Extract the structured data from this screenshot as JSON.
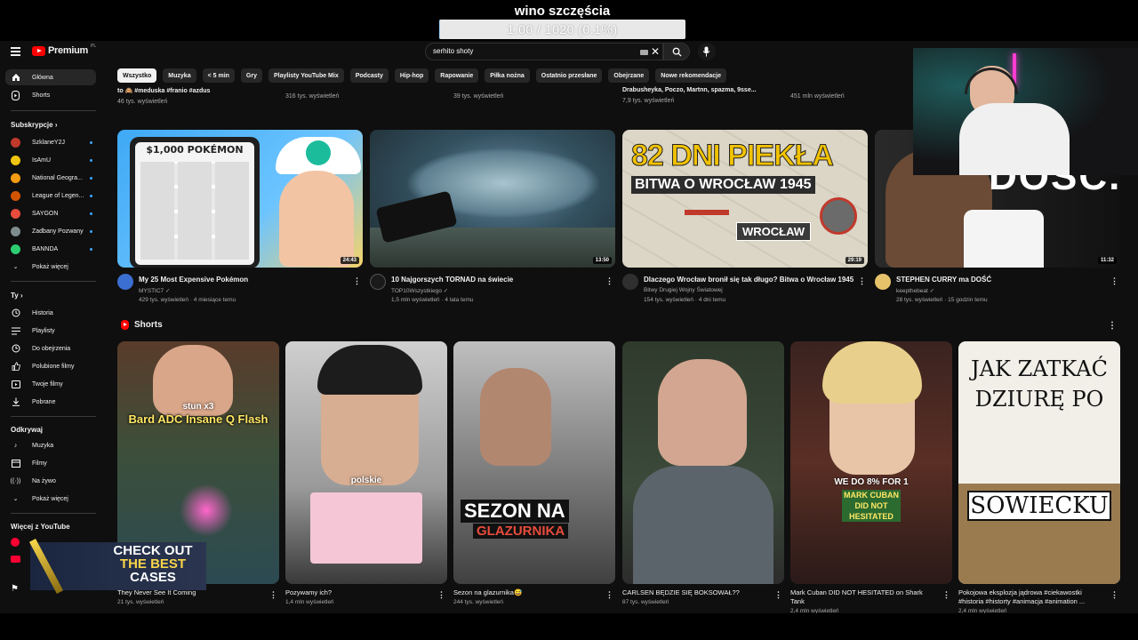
{
  "overlay": {
    "title": "wino szczęścia",
    "progress_text": "1.00 / 1020 (0.1%)",
    "progress_fraction": 0.001
  },
  "masthead": {
    "logo_text": "Premium",
    "logo_region": "PL",
    "search_value": "serhito shoty"
  },
  "sidebar": {
    "main": [
      {
        "label": "Główna",
        "icon": "home-icon"
      },
      {
        "label": "Shorts",
        "icon": "shorts-icon"
      }
    ],
    "subs_head": "Subskrypcje",
    "subs": [
      {
        "label": "SzklaneY2J",
        "color": "#c0392b"
      },
      {
        "label": "IsAmU",
        "color": "#f1c40f"
      },
      {
        "label": "National Geogra...",
        "color": "#f39c12"
      },
      {
        "label": "League of Legen...",
        "color": "#d35400"
      },
      {
        "label": "SAYGON",
        "color": "#e74c3c"
      },
      {
        "label": "Zadbany Pozwany",
        "color": "#7f8c8d"
      },
      {
        "label": "BANNDA",
        "color": "#2ecc71"
      }
    ],
    "subs_more": "Pokaż więcej",
    "you_head": "Ty",
    "you": [
      {
        "label": "Historia",
        "icon": "history-icon"
      },
      {
        "label": "Playlisty",
        "icon": "playlist-icon"
      },
      {
        "label": "Do obejrzenia",
        "icon": "watch-later-icon"
      },
      {
        "label": "Polubione filmy",
        "icon": "like-icon"
      },
      {
        "label": "Twoje filmy",
        "icon": "your-videos-icon"
      },
      {
        "label": "Pobrane",
        "icon": "download-icon"
      }
    ],
    "explore_head": "Odkrywaj",
    "explore": [
      {
        "label": "Muzyka",
        "icon": "music-icon"
      },
      {
        "label": "Filmy",
        "icon": "movies-icon"
      },
      {
        "label": "Na żywo",
        "icon": "live-icon"
      },
      {
        "label": "Pokaż więcej",
        "icon": "chevron-down-icon"
      }
    ],
    "more_head": "Więcej z YouTube"
  },
  "chips": [
    "Wszystko",
    "Muzyka",
    "< 5 min",
    "Gry",
    "Playlisty YouTube Mix",
    "Podcasty",
    "Hip-hop",
    "Rapowanie",
    "Piłka nożna",
    "Ostatnio przesłane",
    "Obejrzane",
    "Nowe rekomendacje"
  ],
  "partial_row": [
    {
      "title": "to 🙈 #meduska #franio #azdus",
      "stats": "46 tys. wyświetleń"
    },
    {
      "title": "",
      "stats": "316 tys. wyświetleń"
    },
    {
      "title": "",
      "stats": "39 tys. wyświetleń"
    },
    {
      "title": "Drabusheyka, Poczo, Martnn, spazma, 9sse...",
      "stats": "7,9 tys. wyświetleń"
    },
    {
      "title": "",
      "stats": "451 mln wyświetleń"
    }
  ],
  "videos": [
    {
      "title": "My 25 Most Expensive Pokémon",
      "channel": "MYSTIC7",
      "stats": "429 tys. wyświetleń · 4 miesiące temu",
      "duration": "24:43",
      "thumb_text": "$1,000 POKÉMON"
    },
    {
      "title": "10 Najgorszych TORNAD na świecie",
      "channel": "TOP10Wszystkiego",
      "stats": "1,5 mln wyświetleń · 4 lata temu",
      "duration": "13:50",
      "thumb_text": ""
    },
    {
      "title": "Dlaczego Wrocław bronił się tak długo? Bitwa o Wrocław 1945",
      "channel": "Bitwy Drugiej Wojny Światowej",
      "stats": "154 tys. wyświetleń · 4 dni temu",
      "duration": "29:19",
      "thumb_text": "82 DNI PIEKŁA",
      "thumb_sub": "BITWA O WROCŁAW 1945",
      "thumb_tag": "WROCŁAW"
    },
    {
      "title": "STEPHEN CURRY ma DOŚĆ",
      "channel": "keepthebeat",
      "stats": "28 tys. wyświetleń · 15 godzin temu",
      "duration": "11:32",
      "thumb_text": "DOŚĆ."
    }
  ],
  "shorts_head": "Shorts",
  "shorts": [
    {
      "title": "They Never See It Coming",
      "stats": "21 tys. wyświetleń",
      "thumb_text": "Bard ADC Insane Q Flash",
      "thumb_sub": "stun x3"
    },
    {
      "title": "Pozywamy ich?",
      "stats": "1,4 mln wyświetleń",
      "thumb_text": "polskie"
    },
    {
      "title": "Sezon na glazurnika😅",
      "stats": "244 tys. wyświetleń",
      "thumb_text": "SEZON NA",
      "thumb_sub": "GLAZURNIKA"
    },
    {
      "title": "CARLSEN BĘDZIE SIĘ BOKSOWAŁ??",
      "stats": "87 tys. wyświetleń",
      "thumb_text": ""
    },
    {
      "title": "Mark Cuban DID NOT HESITATED on Shark Tank",
      "stats": "2,4 mln wyświetleń",
      "thumb_text": "WE DO 8% FOR 1",
      "thumb_sub": "MARK CUBAN DID NOT HESITATED"
    },
    {
      "title": "Pokojowa eksplozja jądrowa #ciekawostki #historia #historty #animacja #animation ...",
      "stats": "2,4 mln wyświetleń",
      "thumb_text": "JAK ZATKAĆ DZIURĘ PO",
      "thumb_sub": "SOWIECKU"
    }
  ],
  "case_ad": {
    "line1": "CHECK OUT",
    "line2": "THE BEST",
    "line3": "CASES"
  }
}
